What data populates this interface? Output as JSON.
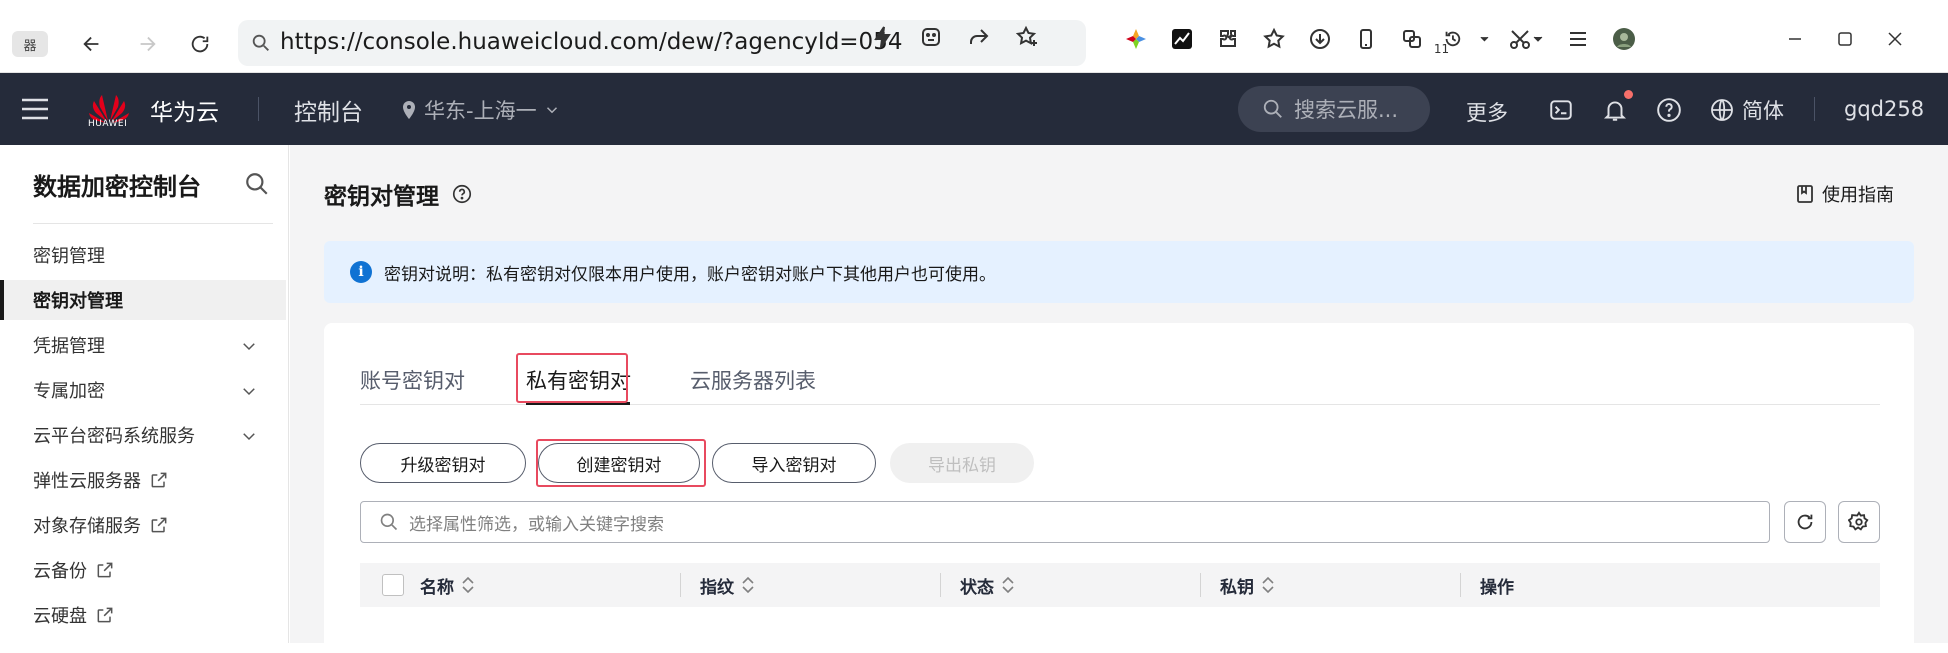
{
  "browser": {
    "tab_chip": "器",
    "url": "https://console.huaweicloud.com/dew/?agencyId=054",
    "download_count": "11"
  },
  "topnav": {
    "logo_text": "HUAWEI",
    "brand": "华为云",
    "console": "控制台",
    "region": "华东-上海一",
    "search_placeholder": "搜索云服...",
    "more": "更多",
    "language": "简体",
    "username": "gqd258"
  },
  "sidebar": {
    "title": "数据加密控制台",
    "items": [
      {
        "label": "密钥管理"
      },
      {
        "label": "密钥对管理"
      },
      {
        "label": "凭据管理"
      },
      {
        "label": "专属加密"
      },
      {
        "label": "云平台密码系统服务"
      },
      {
        "label": "弹性云服务器"
      },
      {
        "label": "对象存储服务"
      },
      {
        "label": "云备份"
      },
      {
        "label": "云硬盘"
      }
    ]
  },
  "main": {
    "title": "密钥对管理",
    "guide": "使用指南",
    "notice": "密钥对说明：私有密钥对仅限本用户使用，账户密钥对账户下其他用户也可使用。",
    "tabs": [
      {
        "label": "账号密钥对"
      },
      {
        "label": "私有密钥对"
      },
      {
        "label": "云服务器列表"
      }
    ],
    "buttons": {
      "upgrade": "升级密钥对",
      "create": "创建密钥对",
      "import": "导入密钥对",
      "export": "导出私钥"
    },
    "filter_placeholder": "选择属性筛选，或输入关键字搜索",
    "columns": [
      "名称",
      "指纹",
      "状态",
      "私钥",
      "操作"
    ]
  },
  "colors": {
    "topnav_bg": "#252b3a",
    "highlight": "#e84a5f",
    "notice_bg": "#e5f1ff",
    "info_icon": "#0f72d3"
  }
}
